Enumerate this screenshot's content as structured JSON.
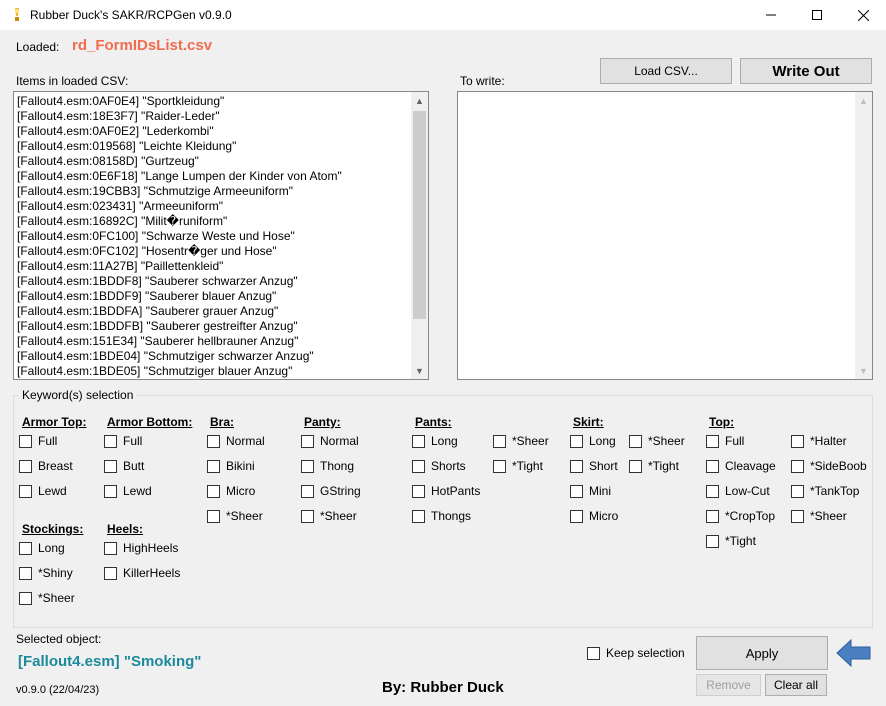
{
  "window": {
    "title": "Rubber Duck's SAKR/RCPGen v0.9.0",
    "min": "—",
    "max": "☐",
    "close": "✕"
  },
  "loaded": {
    "label": "Loaded:",
    "file": "rd_FormIDsList.csv"
  },
  "items_label": "Items in loaded CSV:",
  "to_write_label": "To write:",
  "buttons": {
    "load_csv": "Load CSV...",
    "write_out": "Write Out",
    "apply": "Apply",
    "remove": "Remove",
    "clear_all": "Clear all"
  },
  "csv_items": [
    "[Fallout4.esm:0AF0E4] \"Sportkleidung\"",
    "[Fallout4.esm:18E3F7] \"Raider-Leder\"",
    "[Fallout4.esm:0AF0E2] \"Lederkombi\"",
    "[Fallout4.esm:019568] \"Leichte Kleidung\"",
    "[Fallout4.esm:08158D] \"Gurtzeug\"",
    "[Fallout4.esm:0E6F18] \"Lange Lumpen der Kinder von Atom\"",
    "[Fallout4.esm:19CBB3] \"Schmutzige Armeeuniform\"",
    "[Fallout4.esm:023431] \"Armeeuniform\"",
    "[Fallout4.esm:16892C] \"Milit�runiform\"",
    "[Fallout4.esm:0FC100] \"Schwarze Weste und Hose\"",
    "[Fallout4.esm:0FC102] \"Hosentr�ger und Hose\"",
    "[Fallout4.esm:11A27B] \"Paillettenkleid\"",
    "[Fallout4.esm:1BDDF8] \"Sauberer schwarzer Anzug\"",
    "[Fallout4.esm:1BDDF9] \"Sauberer blauer Anzug\"",
    "[Fallout4.esm:1BDDFA] \"Sauberer grauer Anzug\"",
    "[Fallout4.esm:1BDDFB] \"Sauberer gestreifter Anzug\"",
    "[Fallout4.esm:151E34] \"Sauberer hellbrauner Anzug\"",
    "[Fallout4.esm:1BDE04] \"Schmutziger schwarzer Anzug\"",
    "[Fallout4.esm:1BDE05] \"Schmutziger blauer Anzug\""
  ],
  "keywords": {
    "title": "Keyword(s) selection",
    "armor_top": {
      "header": "Armor Top:",
      "options": [
        "Full",
        "Breast",
        "Lewd"
      ]
    },
    "armor_bottom": {
      "header": "Armor Bottom:",
      "options": [
        "Full",
        "Butt",
        "Lewd"
      ]
    },
    "bra": {
      "header": "Bra:",
      "options": [
        "Normal",
        "Bikini",
        "Micro",
        "*Sheer"
      ]
    },
    "panty": {
      "header": "Panty:",
      "options": [
        "Normal",
        "Thong",
        "GString",
        "*Sheer"
      ]
    },
    "pants": {
      "header": "Pants:",
      "options": [
        "Long",
        "Shorts",
        "HotPants",
        "Thongs"
      ],
      "extra": [
        "*Sheer",
        "*Tight"
      ]
    },
    "skirt": {
      "header": "Skirt:",
      "options": [
        "Long",
        "Short",
        "Mini",
        "Micro"
      ],
      "extra": [
        "*Sheer",
        "*Tight"
      ]
    },
    "top": {
      "header": "Top:",
      "options": [
        "Full",
        "Cleavage",
        "Low-Cut",
        "*CropTop",
        "*Tight"
      ],
      "extra": [
        "*Halter",
        "*SideBoob",
        "*TankTop",
        "*Sheer"
      ]
    },
    "stockings": {
      "header": "Stockings:",
      "options": [
        "Long",
        "*Shiny",
        "*Sheer"
      ]
    },
    "heels": {
      "header": "Heels:",
      "options": [
        "HighHeels",
        "KillerHeels"
      ]
    }
  },
  "selected": {
    "label": "Selected object:",
    "value": "[Fallout4.esm] \"Smoking\""
  },
  "keep_selection": "Keep selection",
  "version": "v0.9.0 (22/04/23)",
  "author": "By: Rubber Duck",
  "colors": {
    "loaded_file": "#f26c4f",
    "selected_value": "#1b8a9b",
    "arrow": "#4a7fc1"
  }
}
